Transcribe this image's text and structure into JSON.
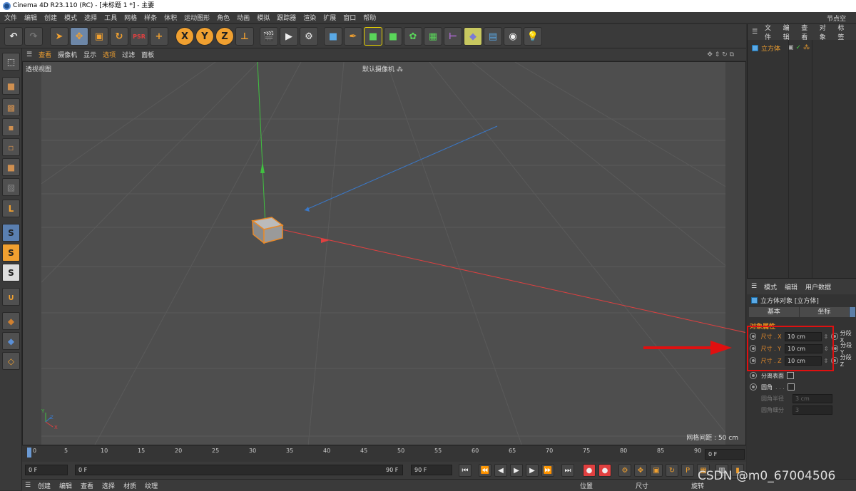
{
  "window": {
    "title": "Cinema 4D R23.110 (RC) - [未标题 1 *] - 主要"
  },
  "menubar": {
    "items": [
      "文件",
      "编辑",
      "创建",
      "模式",
      "选择",
      "工具",
      "网格",
      "样条",
      "体积",
      "运动图形",
      "角色",
      "动画",
      "模拟",
      "跟踪器",
      "渲染",
      "扩展",
      "窗口",
      "帮助"
    ],
    "right_label": "节点空"
  },
  "viewport": {
    "menu": [
      "查看",
      "摄像机",
      "显示",
      "选项",
      "过滤",
      "面板"
    ],
    "view_name": "透视视图",
    "camera": "默认摄像机 ⁂",
    "grid_spacing": "网格间距 : 50 cm",
    "axis_labels": {
      "y": "Y",
      "z": "Z",
      "x": "X"
    }
  },
  "timeline": {
    "ticks": [
      "0",
      "5",
      "10",
      "15",
      "20",
      "25",
      "30",
      "35",
      "40",
      "45",
      "50",
      "55",
      "60",
      "65",
      "70",
      "75",
      "80",
      "85",
      "90"
    ],
    "current_frame": "0 F",
    "start_frame": "0 F",
    "start_min": "0 F",
    "end_frame": "90 F",
    "end_max": "90 F"
  },
  "bottombar": {
    "items": [
      "创建",
      "编辑",
      "查看",
      "选择",
      "材质",
      "纹理"
    ],
    "coord_headers": [
      "位置",
      "尺寸",
      "旋转"
    ]
  },
  "object_manager": {
    "menu": [
      "文件",
      "编辑",
      "查看",
      "对象",
      "标签"
    ],
    "object_name": "立方体"
  },
  "attributes": {
    "menu": [
      "模式",
      "编辑",
      "用户数据"
    ],
    "title": "立方体对象 [立方体]",
    "tabs": [
      "基本",
      "坐标"
    ],
    "section": "对象属性",
    "size_x_label": "尺寸 . X",
    "size_x": "10 cm",
    "size_y_label": "尺寸 . Y",
    "size_y": "10 cm",
    "size_z_label": "尺寸 . Z",
    "size_z": "10 cm",
    "seg_x": "分段 X",
    "seg_y": "分段 Y",
    "seg_z": "分段 Z",
    "separate_surfaces": "分离表面",
    "fillet": "圆角",
    "fillet_dots": ". . .",
    "fillet_radius_label": "圆角半径",
    "fillet_radius": "3 cm",
    "fillet_subdiv_label": "圆角细分",
    "fillet_subdiv": "3"
  },
  "watermark": "CSDN @m0_67004506",
  "colors": {
    "accent_orange": "#e08a1e",
    "highlight_red": "#e01010",
    "axis_x": "#e04040",
    "axis_y": "#40c040",
    "axis_z": "#3a78c8"
  }
}
